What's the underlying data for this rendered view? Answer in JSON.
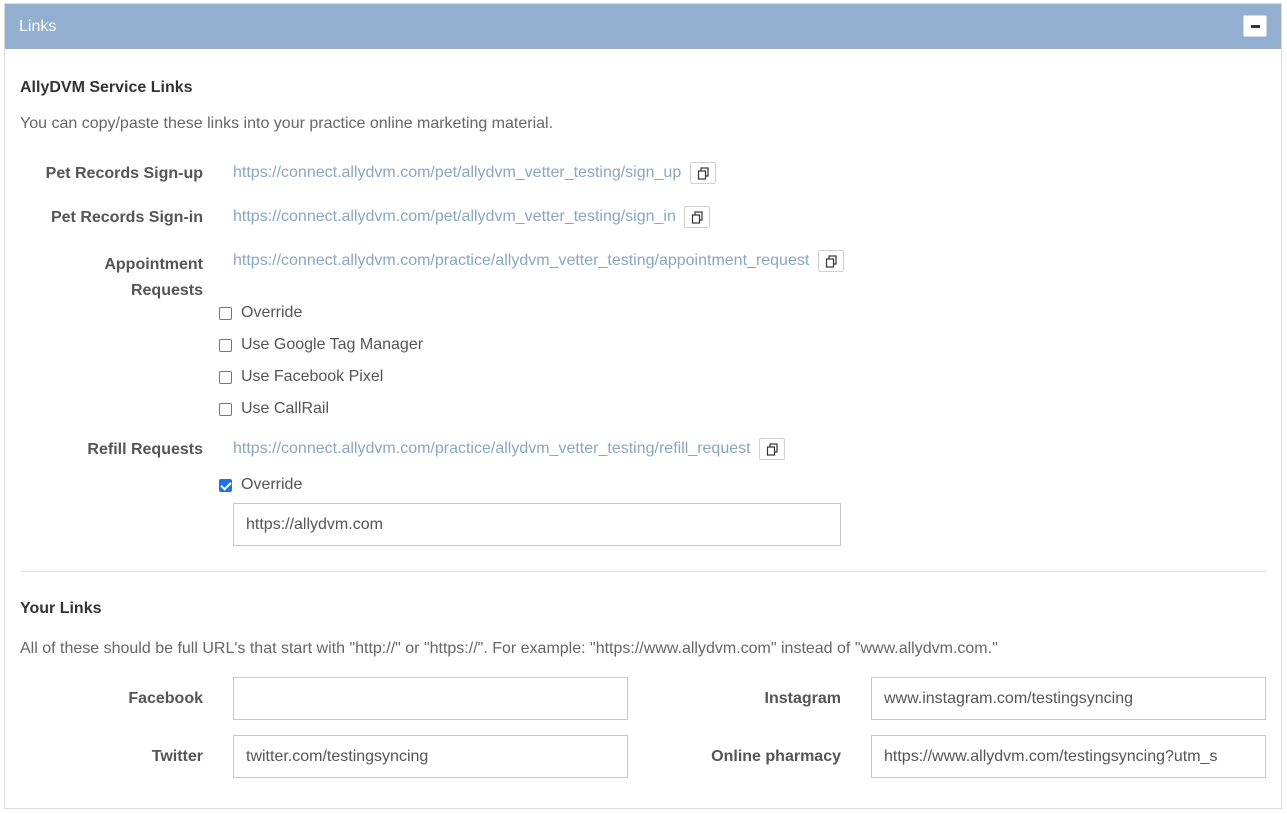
{
  "panel": {
    "title": "Links"
  },
  "service_links": {
    "title": "AllyDVM Service Links",
    "description": "You can copy/paste these links into your practice online marketing material.",
    "pet_signup": {
      "label": "Pet Records Sign-up",
      "url": "https://connect.allydvm.com/pet/allydvm_vetter_testing/sign_up"
    },
    "pet_signin": {
      "label": "Pet Records Sign-in",
      "url": "https://connect.allydvm.com/pet/allydvm_vetter_testing/sign_in"
    },
    "appointment": {
      "label_line1": "Appointment",
      "label_line2": "Requests",
      "url": "https://connect.allydvm.com/practice/allydvm_vetter_testing/appointment_request",
      "options": [
        {
          "label": "Override",
          "checked": false
        },
        {
          "label": "Use Google Tag Manager",
          "checked": false
        },
        {
          "label": "Use Facebook Pixel",
          "checked": false
        },
        {
          "label": "Use CallRail",
          "checked": false
        }
      ]
    },
    "refill": {
      "label": "Refill Requests",
      "url": "https://connect.allydvm.com/practice/allydvm_vetter_testing/refill_request",
      "override_label": "Override",
      "override_checked": true,
      "override_value": "https://allydvm.com"
    }
  },
  "your_links": {
    "title": "Your Links",
    "description": "All of these should be full URL's that start with \"http://\" or \"https://\". For example: \"https://www.allydvm.com\" instead of \"www.allydvm.com.\"",
    "facebook": {
      "label": "Facebook",
      "value": ""
    },
    "instagram": {
      "label": "Instagram",
      "value": "www.instagram.com/testingsyncing"
    },
    "twitter": {
      "label": "Twitter",
      "value": "twitter.com/testingsyncing"
    },
    "pharmacy": {
      "label": "Online pharmacy",
      "value": "https://www.allydvm.com/testingsyncing?utm_s"
    }
  },
  "icons": {
    "copy": "copy-icon",
    "collapse": "minus-icon"
  },
  "colors": {
    "header": "#93afcf",
    "link": "#8aa6c1",
    "checkbox": "#1a73e8"
  }
}
